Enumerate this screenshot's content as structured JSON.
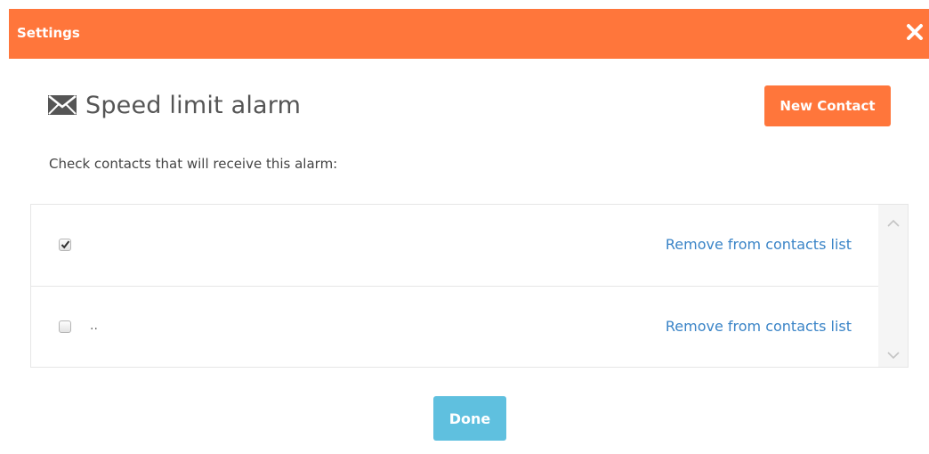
{
  "header": {
    "title": "Settings",
    "close_icon": "close-icon"
  },
  "alarm": {
    "icon": "envelope-icon",
    "title": "Speed limit alarm"
  },
  "toolbar": {
    "new_contact_label": "New Contact"
  },
  "instructions": "Check contacts that will receive this alarm:",
  "contacts": [
    {
      "checked": true,
      "name": "",
      "remove_label": "Remove from contacts list"
    },
    {
      "checked": false,
      "name": "..",
      "remove_label": "Remove from contacts list"
    }
  ],
  "footer": {
    "done_label": "Done"
  },
  "colors": {
    "accent": "#ff763b",
    "done": "#5fc0df",
    "link": "#3a84c7"
  }
}
